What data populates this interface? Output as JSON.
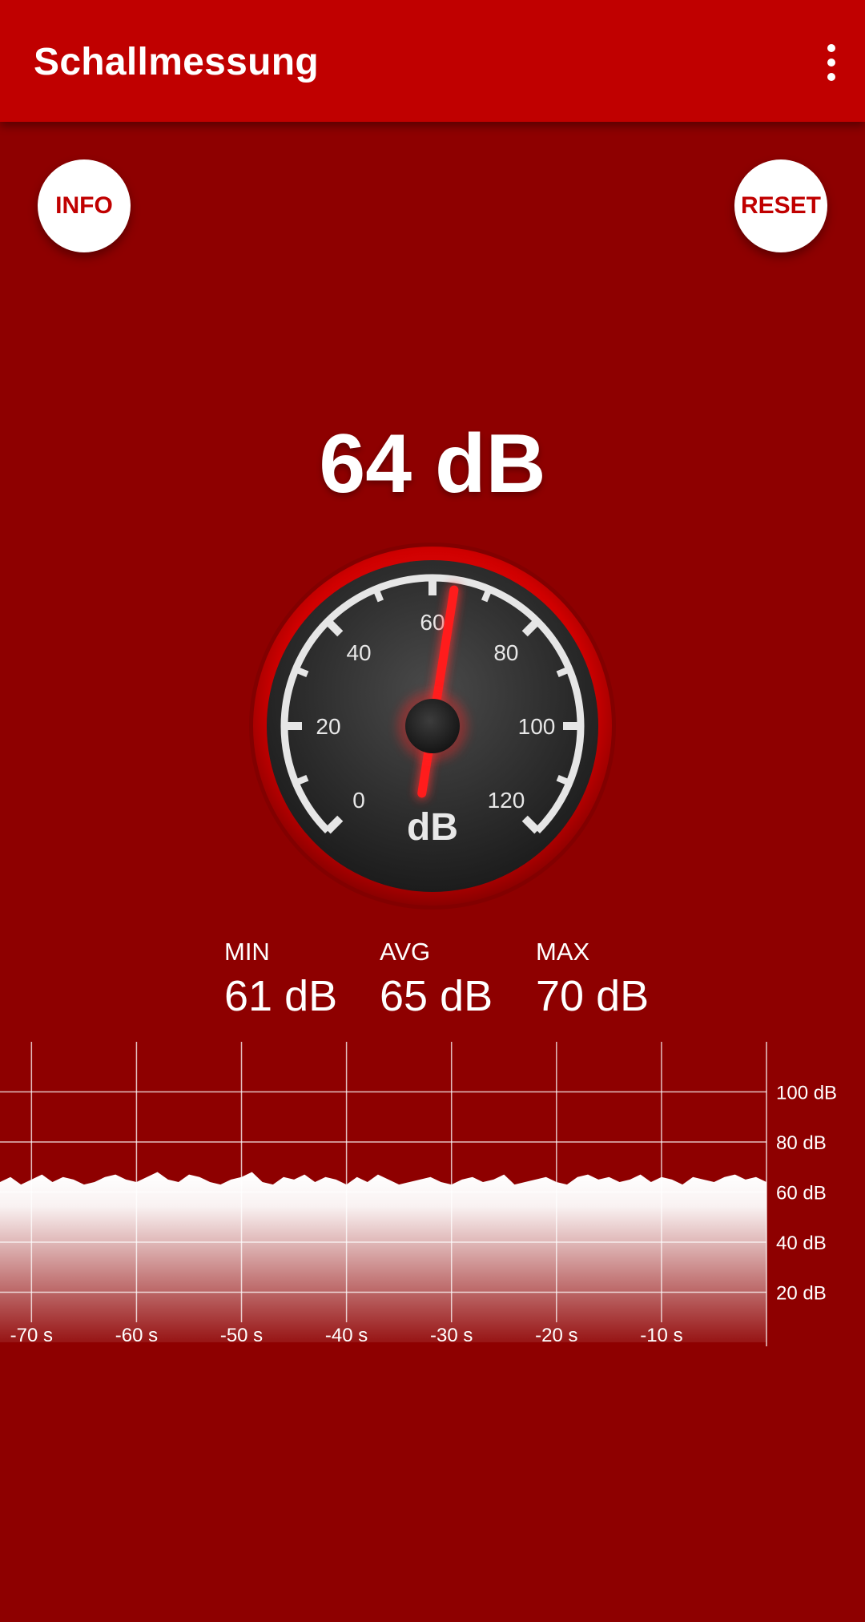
{
  "app": {
    "title": "Schallmessung",
    "menu_icon": "more-vert-icon"
  },
  "buttons": {
    "info_label": "INFO",
    "reset_label": "RESET"
  },
  "meter": {
    "current_value": "64 dB",
    "current_db": 64,
    "unit_label": "dB",
    "scale": {
      "min": 0,
      "max": 120,
      "labels": [
        "0",
        "20",
        "40",
        "60",
        "80",
        "100",
        "120"
      ]
    }
  },
  "stats": {
    "min_label": "MIN",
    "min_value": "61 dB",
    "avg_label": "AVG",
    "avg_value": "65 dB",
    "max_label": "MAX",
    "max_value": "70 dB"
  },
  "chart_data": {
    "type": "area",
    "title": "",
    "xlabel": "",
    "ylabel": "",
    "x_tick_labels": [
      "-70 s",
      "-60 s",
      "-50 s",
      "-40 s",
      "-30 s",
      "-20 s",
      "-10 s"
    ],
    "y_tick_labels": [
      "100 dB",
      "80 dB",
      "60 dB",
      "40 dB",
      "20 dB"
    ],
    "xlim": [
      -73,
      0
    ],
    "ylim": [
      0,
      120
    ],
    "grid": true,
    "series": [
      {
        "values": [
          64,
          66,
          63,
          65,
          67,
          64,
          66,
          65,
          63,
          64,
          66,
          67,
          65,
          64,
          66,
          68,
          65,
          64,
          67,
          66,
          64,
          63,
          65,
          66,
          68,
          64,
          63,
          66,
          65,
          67,
          64,
          66,
          65,
          63,
          66,
          64,
          67,
          65,
          63,
          64,
          65,
          66,
          64,
          63,
          65,
          66,
          64,
          65,
          67,
          63,
          64,
          65,
          66,
          64,
          63,
          66,
          67,
          65,
          66,
          64,
          65,
          67,
          64,
          66,
          65,
          63,
          66,
          65,
          64,
          66,
          67,
          65,
          66,
          64
        ]
      }
    ]
  },
  "colors": {
    "background": "#8e0000",
    "appbar": "#c00000",
    "needle": "#ff1c1c",
    "gauge_face": "#2d2d2d",
    "text": "#ffffff"
  }
}
